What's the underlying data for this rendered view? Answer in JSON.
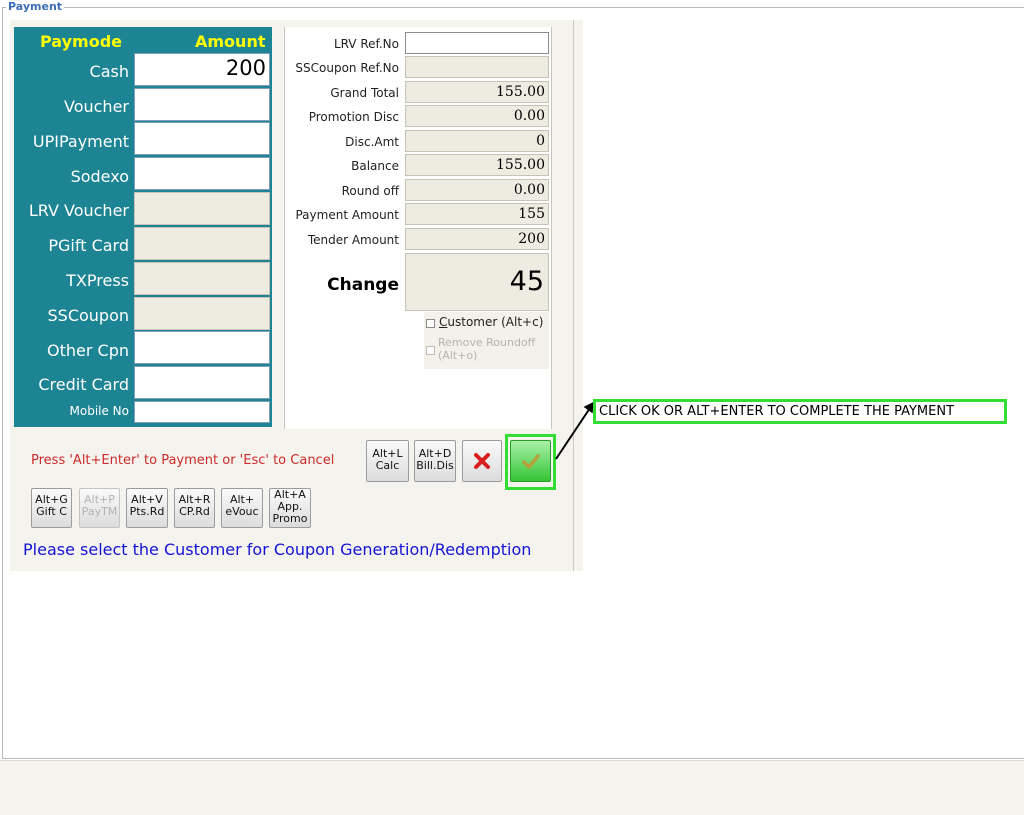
{
  "window": {
    "title": "Payment"
  },
  "paymodes": {
    "header_mode": "Paymode",
    "header_amount": "Amount",
    "rows": [
      {
        "label": "Cash",
        "value": "200",
        "enabled": true
      },
      {
        "label": "Voucher",
        "value": "",
        "enabled": true
      },
      {
        "label": "UPIPayment",
        "value": "",
        "enabled": true
      },
      {
        "label": "Sodexo",
        "value": "",
        "enabled": true
      },
      {
        "label": "LRV Voucher",
        "value": "",
        "enabled": false
      },
      {
        "label": "PGift Card",
        "value": "",
        "enabled": false
      },
      {
        "label": "TXPress",
        "value": "",
        "enabled": false
      },
      {
        "label": "SSCoupon",
        "value": "",
        "enabled": false
      },
      {
        "label": "Other Cpn",
        "value": "",
        "enabled": true
      },
      {
        "label": "Credit Card",
        "value": "",
        "enabled": true
      }
    ],
    "mobile_label": "Mobile No",
    "mobile_value": ""
  },
  "summary": {
    "fields": [
      {
        "label": "LRV Ref.No",
        "value": ""
      },
      {
        "label": "SSCoupon Ref.No",
        "value": ""
      },
      {
        "label": "Grand Total",
        "value": "155.00"
      },
      {
        "label": "Promotion Disc",
        "value": "0.00"
      },
      {
        "label": "Disc.Amt",
        "value": "0"
      },
      {
        "label": "Balance",
        "value": "155.00"
      },
      {
        "label": "Round off",
        "value": "0.00"
      },
      {
        "label": "Payment Amount",
        "value": "155"
      },
      {
        "label": "Tender Amount",
        "value": "200"
      }
    ],
    "change_label": "Change",
    "change_value": "45",
    "customer_checkbox": "ustomer (Alt+c)",
    "customer_checkbox_underlined": "C",
    "roundoff_checkbox_line1": "Remove Roundoff",
    "roundoff_checkbox_line2": "(Alt+o)"
  },
  "actions": {
    "hint": "Press 'Alt+Enter' to Payment or 'Esc' to Cancel",
    "calc_line1": "Alt+L",
    "calc_line2": "Calc",
    "billdis_line1": "Alt+D",
    "billdis_line2": "Bill.Dis",
    "cancel_icon": "close-x-icon",
    "ok_icon": "check-icon"
  },
  "shortcuts": [
    {
      "line1": "Alt+G",
      "line2": "Gift C",
      "enabled": true
    },
    {
      "line1": "Alt+P",
      "line2": "PayTM",
      "enabled": false
    },
    {
      "line1": "Alt+V",
      "line2": "Pts.Rd",
      "enabled": true
    },
    {
      "line1": "Alt+R",
      "line2": "CP.Rd",
      "enabled": true
    },
    {
      "line1": "Alt+",
      "line2": "eVouc",
      "enabled": true
    },
    {
      "line1": "Alt+A",
      "line2": "App.",
      "line3": "Promo",
      "enabled": true
    }
  ],
  "notice": "Please select the Customer for Coupon Generation/Redemption",
  "callout": "CLICK OK OR ALT+ENTER TO COMPLETE THE PAYMENT",
  "colors": {
    "teal": "#1d8494",
    "yellow": "#ffff00",
    "hint_red": "#cc2b2b",
    "notice_blue": "#1414d4",
    "callout_green": "#33dd33"
  }
}
